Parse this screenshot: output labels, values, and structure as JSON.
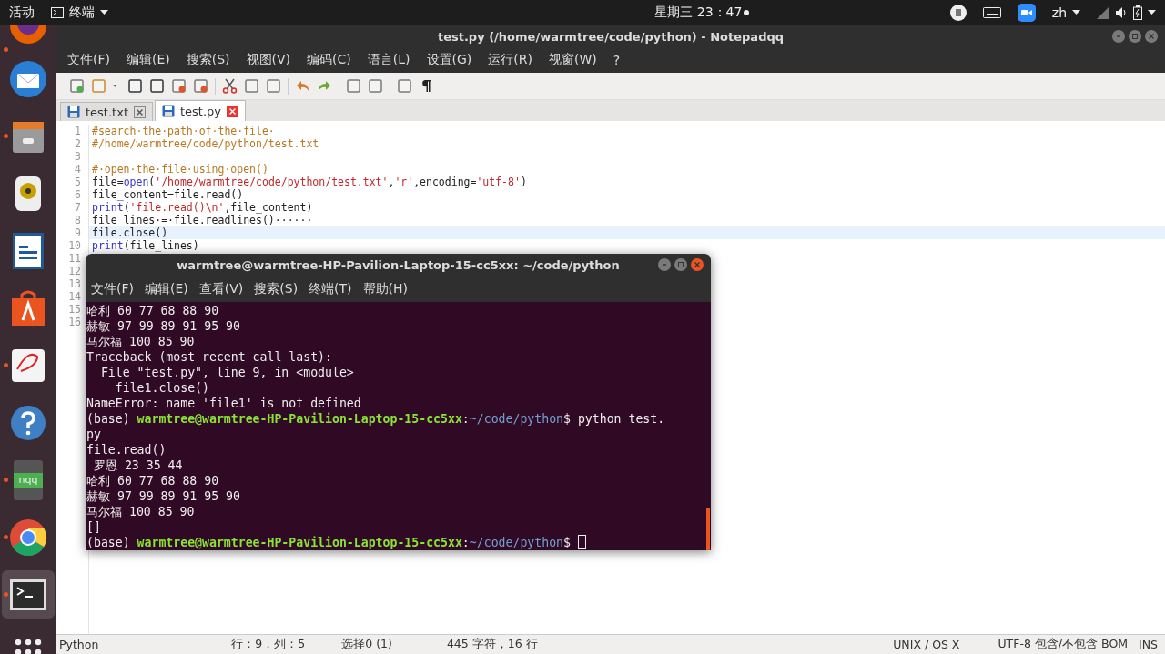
{
  "top_bar": {
    "activities": "活动",
    "app_menu": "终端",
    "clock": "星期三 23：47",
    "input_method": "zh"
  },
  "dock": {
    "items": [
      {
        "kind": "firefox",
        "running": true,
        "selected": false
      },
      {
        "kind": "mail",
        "running": false,
        "selected": false
      },
      {
        "kind": "files",
        "running": true,
        "selected": false
      },
      {
        "kind": "music",
        "running": false,
        "selected": false
      },
      {
        "kind": "writer",
        "running": false,
        "selected": false
      },
      {
        "kind": "store",
        "running": false,
        "selected": false
      },
      {
        "kind": "reader",
        "running": true,
        "selected": false
      },
      {
        "kind": "help",
        "running": false,
        "selected": false
      },
      {
        "kind": "notebook",
        "label": "nqq",
        "running": true,
        "selected": false
      },
      {
        "kind": "chrome",
        "running": true,
        "selected": false
      },
      {
        "kind": "terminal",
        "running": true,
        "selected": true
      },
      {
        "kind": "apps",
        "running": false,
        "selected": false
      }
    ]
  },
  "editor": {
    "title": "test.py (/home/warmtree/code/python) - Notepadqq",
    "menu": [
      "文件(F)",
      "编辑(E)",
      "搜索(S)",
      "视图(V)",
      "编码(C)",
      "语言(L)",
      "设置(G)",
      "运行(R)",
      "视窗(W)",
      "?"
    ],
    "tabs": [
      {
        "label": "test.txt",
        "selected": false
      },
      {
        "label": "test.py",
        "selected": true
      }
    ],
    "lines": [
      {
        "number": "1",
        "current": false,
        "tokens": [
          {
            "kind": "comment",
            "text": "#search·the·path·of·the·file·"
          }
        ]
      },
      {
        "number": "2",
        "current": false,
        "tokens": [
          {
            "kind": "comment",
            "text": "#/home/warmtree/code/python/test.txt"
          }
        ]
      },
      {
        "number": "3",
        "current": false
      },
      {
        "number": "4",
        "current": false,
        "tokens": [
          {
            "kind": "comment",
            "text": "#·open·the·file·using·open()"
          }
        ]
      },
      {
        "number": "5",
        "current": false,
        "tokens": [
          {
            "kind": "plain",
            "text": "file="
          },
          {
            "kind": "builtin",
            "text": "open"
          },
          {
            "kind": "plain",
            "text": "("
          },
          {
            "kind": "string",
            "text": "'/home/warmtree/code/python/test.txt'"
          },
          {
            "kind": "plain",
            "text": ","
          },
          {
            "kind": "string",
            "text": "'r'"
          },
          {
            "kind": "plain",
            "text": ",encoding="
          },
          {
            "kind": "string",
            "text": "'utf-8'"
          },
          {
            "kind": "plain",
            "text": ")"
          }
        ]
      },
      {
        "number": "6",
        "current": false,
        "tokens": [
          {
            "kind": "plain",
            "text": "file_content=file.read()"
          }
        ]
      },
      {
        "number": "7",
        "current": false,
        "tokens": [
          {
            "kind": "builtin",
            "text": "print"
          },
          {
            "kind": "plain",
            "text": "("
          },
          {
            "kind": "string",
            "text": "'file.read()\\n'"
          },
          {
            "kind": "plain",
            "text": ",file_content)"
          }
        ]
      },
      {
        "number": "8",
        "current": false,
        "tokens": [
          {
            "kind": "plain",
            "text": "file_lines·=·file.readlines()······"
          }
        ]
      },
      {
        "number": "9",
        "current": true,
        "tokens": [
          {
            "kind": "plain",
            "text": "file.close()"
          }
        ]
      },
      {
        "number": "10",
        "current": false,
        "tokens": [
          {
            "kind": "builtin",
            "text": "print"
          },
          {
            "kind": "plain",
            "text": "(file_lines)"
          }
        ]
      },
      {
        "number": "11",
        "current": false
      },
      {
        "number": "12",
        "current": false
      },
      {
        "number": "13",
        "current": false
      },
      {
        "number": "14",
        "current": false
      },
      {
        "number": "15",
        "current": false
      },
      {
        "number": "16",
        "current": false
      }
    ],
    "status_bar": {
      "language": "Python",
      "position": "行：9，列：5",
      "selection": "选择0 (1)",
      "stats": "445 字符，16 行",
      "line_endings": "UNIX / OS X",
      "encoding": "UTF-8 包含/不包含 BOM",
      "mode": "INS"
    }
  },
  "terminal": {
    "title": "warmtree@warmtree-HP-Pavilion-Laptop-15-cc5xx: ~/code/python",
    "menu": [
      "文件(F)",
      "编辑(E)",
      "查看(V)",
      "搜索(S)",
      "终端(T)",
      "帮助(H)"
    ],
    "lines": [
      [
        {
          "kind": "plain",
          "text": "哈利 60 77 68 88 90"
        }
      ],
      [
        {
          "kind": "plain",
          "text": "赫敏 97 99 89 91 95 90"
        }
      ],
      [
        {
          "kind": "plain",
          "text": "马尔福 100 85 90"
        }
      ],
      [
        {
          "kind": "plain",
          "text": "Traceback (most recent call last):"
        }
      ],
      [
        {
          "kind": "plain",
          "text": "  File \"test.py\", line 9, in <module>"
        }
      ],
      [
        {
          "kind": "plain",
          "text": "    file1.close()"
        }
      ],
      [
        {
          "kind": "plain",
          "text": "NameError: name 'file1' is not defined"
        }
      ],
      [
        {
          "kind": "plain",
          "text": "(base) "
        },
        {
          "kind": "user",
          "text": "warmtree@warmtree-HP-Pavilion-Laptop-15-cc5xx"
        },
        {
          "kind": "plain",
          "text": ":"
        },
        {
          "kind": "path",
          "text": "~/code/python"
        },
        {
          "kind": "plain",
          "text": "$ python test."
        }
      ],
      [
        {
          "kind": "plain",
          "text": "py"
        }
      ],
      [
        {
          "kind": "plain",
          "text": "file.read()"
        }
      ],
      [
        {
          "kind": "plain",
          "text": " 罗恩 23 35 44"
        }
      ],
      [
        {
          "kind": "plain",
          "text": "哈利 60 77 68 88 90"
        }
      ],
      [
        {
          "kind": "plain",
          "text": "赫敏 97 99 89 91 95 90"
        }
      ],
      [
        {
          "kind": "plain",
          "text": "马尔福 100 85 90"
        }
      ],
      [
        {
          "kind": "plain",
          "text": "[]"
        }
      ],
      [
        {
          "kind": "plain",
          "text": "(base) "
        },
        {
          "kind": "user",
          "text": "warmtree@warmtree-HP-Pavilion-Laptop-15-cc5xx"
        },
        {
          "kind": "plain",
          "text": ":"
        },
        {
          "kind": "path",
          "text": "~/code/python"
        },
        {
          "kind": "plain",
          "text": "$ "
        },
        {
          "kind": "cursor"
        }
      ]
    ]
  }
}
